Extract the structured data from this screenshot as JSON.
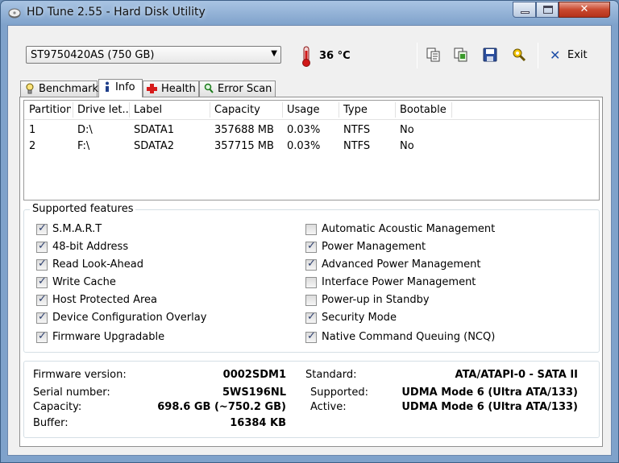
{
  "window": {
    "title": "HD Tune 2.55 - Hard Disk Utility"
  },
  "toolbar": {
    "drive": "ST9750420AS (750 GB)",
    "temperature": "36 °C",
    "exit_label": "Exit",
    "icons": [
      "copy-text-icon",
      "copy-screenshot-icon",
      "save-icon",
      "options-icon"
    ]
  },
  "tabs": [
    {
      "label": "Benchmark",
      "icon": "lightbulb-icon"
    },
    {
      "label": "Info",
      "icon": "info-icon",
      "active": true
    },
    {
      "label": "Health",
      "icon": "health-cross-icon"
    },
    {
      "label": "Error Scan",
      "icon": "magnifier-icon"
    }
  ],
  "partitions": {
    "columns": [
      "Partition",
      "Drive let...",
      "Label",
      "Capacity",
      "Usage",
      "Type",
      "Bootable"
    ],
    "rows": [
      [
        "1",
        "D:\\",
        "SDATA1",
        "357688 MB",
        "0.03%",
        "NTFS",
        "No"
      ],
      [
        "2",
        "F:\\",
        "SDATA2",
        "357715 MB",
        "0.03%",
        "NTFS",
        "No"
      ]
    ]
  },
  "features": {
    "title": "Supported features",
    "left": [
      {
        "label": "S.M.A.R.T",
        "checked": true
      },
      {
        "label": "48-bit Address",
        "checked": true
      },
      {
        "label": "Read Look-Ahead",
        "checked": true
      },
      {
        "label": "Write Cache",
        "checked": true
      },
      {
        "label": "Host Protected Area",
        "checked": true
      },
      {
        "label": "Device Configuration Overlay",
        "checked": true
      },
      {
        "label": "Firmware Upgradable",
        "checked": true
      }
    ],
    "right": [
      {
        "label": "Automatic Acoustic Management",
        "checked": false
      },
      {
        "label": "Power Management",
        "checked": true
      },
      {
        "label": "Advanced Power Management",
        "checked": true
      },
      {
        "label": "Interface Power Management",
        "checked": false
      },
      {
        "label": "Power-up in Standby",
        "checked": false
      },
      {
        "label": "Security Mode",
        "checked": true
      },
      {
        "label": "Native Command Queuing (NCQ)",
        "checked": true
      }
    ]
  },
  "specs": {
    "firmware_label": "Firmware version:",
    "firmware": "0002SDM1",
    "serial_label": "Serial number:",
    "serial": "5WS196NL",
    "capacity_label": "Capacity:",
    "capacity": "698.6 GB (~750.2 GB)",
    "buffer_label": "Buffer:",
    "buffer": "16384 KB",
    "standard_label": "Standard:",
    "standard": "ATA/ATAPI-0 - SATA II",
    "supported_label": "Supported:",
    "supported": "UDMA Mode 6 (Ultra ATA/133)",
    "active_label": "Active:",
    "active": "UDMA Mode 6 (Ultra ATA/133)"
  },
  "colors": {
    "accent": "#1f4fa8",
    "close": "#c9492f",
    "thermo": "#d01818"
  }
}
